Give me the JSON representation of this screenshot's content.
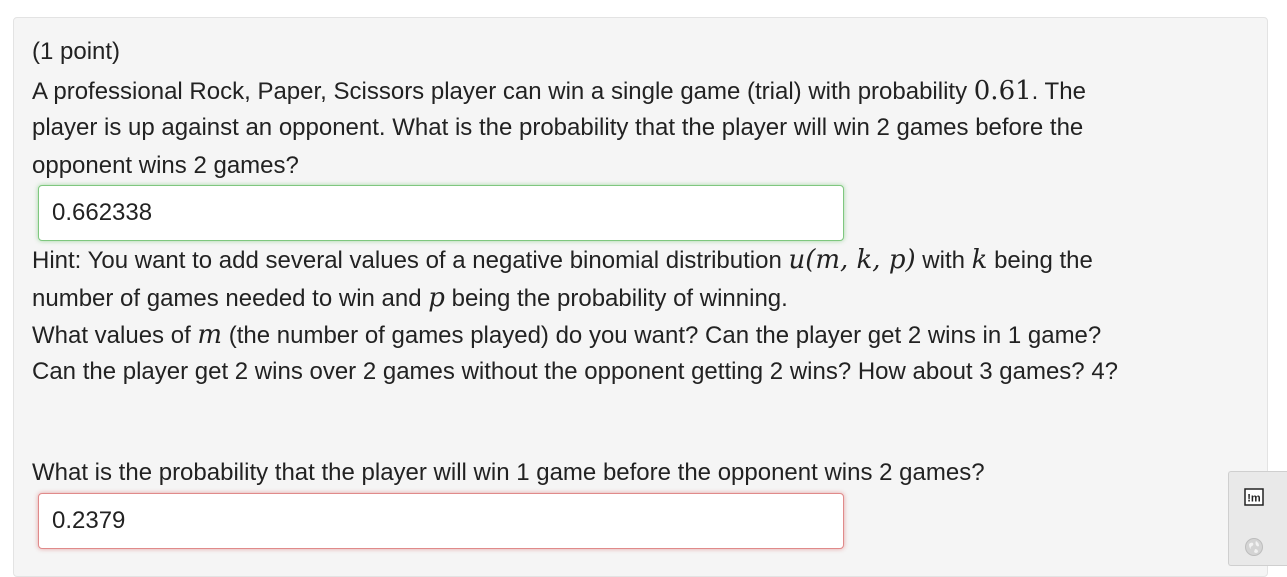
{
  "problem": {
    "points": "(1 point)",
    "line1_pre": "A professional Rock, Paper, Scissors player can win a single game (trial) with probability ",
    "line1_math": "0.61",
    "line1_post": ". The",
    "line2": "player is up against an opponent. What is the probability that the player will win 2 games before the",
    "line3": "opponent wins 2 games?",
    "answer1": "0.662338",
    "hint": {
      "pre": "Hint: You want to add several values of a negative binomial distribution ",
      "math_u": "u(m, k, p)",
      "mid": " with ",
      "math_k": "k",
      "post": " being the",
      "line2_pre": "number of games needed to win and ",
      "math_p": "p",
      "line2_post": " being the probability of winning.",
      "line3_pre": "What values of ",
      "math_m": "m",
      "line3_post": " (the number of games played) do you want? Can the player get 2 wins in 1 game?",
      "line4": "Can the player get 2 wins over 2 games without the opponent getting 2 wins? How about 3 games? 4?"
    },
    "question2": "What is the probability that the player will win 1 game before the opponent wins 2 games?",
    "answer2": "0.2379"
  },
  "tools": {
    "mathml_label": "!m"
  },
  "colors": {
    "correct_border": "#7fc77f",
    "incorrect_border": "#e08a8a",
    "panel_bg": "#f5f5f5"
  }
}
